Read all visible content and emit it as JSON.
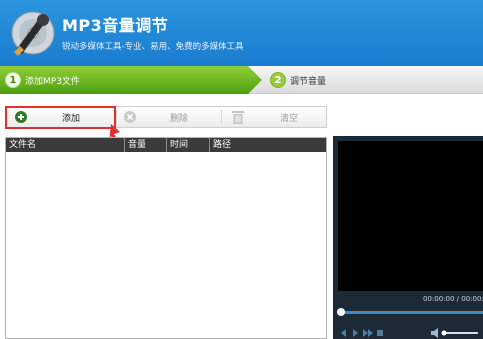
{
  "app": {
    "title": "MP3音量调节",
    "subtitle": "锐动多媒体工具-专业、易用、免费的多媒体工具"
  },
  "steps": [
    {
      "num": "1",
      "label": "添加MP3文件",
      "active": true
    },
    {
      "num": "2",
      "label": "调节音量",
      "active": false
    }
  ],
  "toolbar": {
    "add_label": "添加",
    "delete_label": "删除",
    "clear_label": "清空"
  },
  "file_list": {
    "columns": [
      "文件名",
      "音量",
      "时间",
      "路径"
    ]
  },
  "player": {
    "timecode": "00:00:00 / 00:00:0"
  },
  "colors": {
    "header_blue": "#1a7ccf",
    "step_green": "#5fae15",
    "highlight_red": "#e0302c"
  },
  "icons": [
    "cd-music-logo-icon",
    "plus-circle-icon",
    "delete-circle-icon",
    "trash-icon",
    "arrow-annotation",
    "volume-icon"
  ]
}
